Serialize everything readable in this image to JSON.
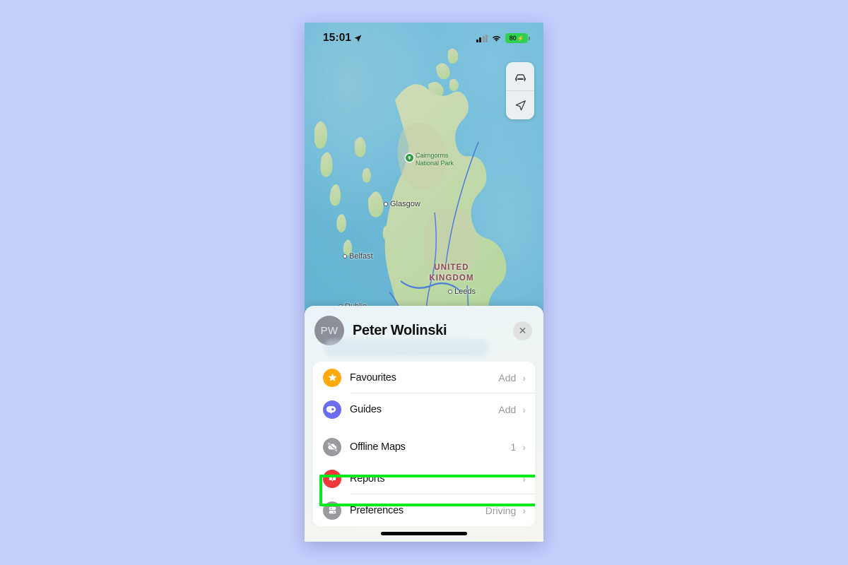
{
  "background_color": "#c5cdfb",
  "status_bar": {
    "time": "15:01",
    "location_arrow_icon": "location-arrow-icon",
    "cellular_icon": "cellular-bars-icon",
    "wifi_icon": "wifi-icon",
    "battery_level": "80",
    "battery_charging_icon": "charging-bolt-icon"
  },
  "map": {
    "controls": [
      {
        "name": "driving-mode-button",
        "icon": "car-icon"
      },
      {
        "name": "locate-me-button",
        "icon": "navigation-arrow-icon"
      }
    ],
    "labels": {
      "park": "Cairngorms\nNational Park",
      "park_line1": "Cairngorms",
      "park_line2": "National Park",
      "glasgow": "Glasgow",
      "belfast": "Belfast",
      "leeds": "Leeds",
      "dublin": "Dublin",
      "country_line1": "UNITED",
      "country_line2": "KINGDOM"
    }
  },
  "sheet": {
    "avatar_initials": "PW",
    "profile_name": "Peter Wolinski",
    "close_label": "✕",
    "items": [
      {
        "label": "Favourites",
        "value": "Add",
        "icon": "star-icon",
        "icon_color": "#ffa90d",
        "name": "row-favourites"
      },
      {
        "label": "Guides",
        "value": "Add",
        "icon": "guides-pin-icon",
        "icon_color": "#6b6ef0",
        "name": "row-guides"
      },
      {
        "label": "Offline Maps",
        "value": "1",
        "icon": "offline-maps-icon",
        "icon_color": "#9a9a9e",
        "name": "row-offline-maps"
      },
      {
        "label": "Reports",
        "value": "",
        "icon": "report-alert-icon",
        "icon_color": "#f0383b",
        "name": "row-reports"
      },
      {
        "label": "Preferences",
        "value": "Driving",
        "icon": "preferences-icon",
        "icon_color": "#9a9a9e",
        "name": "row-preferences"
      }
    ],
    "chevron": "›"
  },
  "annotation": {
    "highlight_color": "#00e81e",
    "highlighted_item": "Offline Maps"
  }
}
